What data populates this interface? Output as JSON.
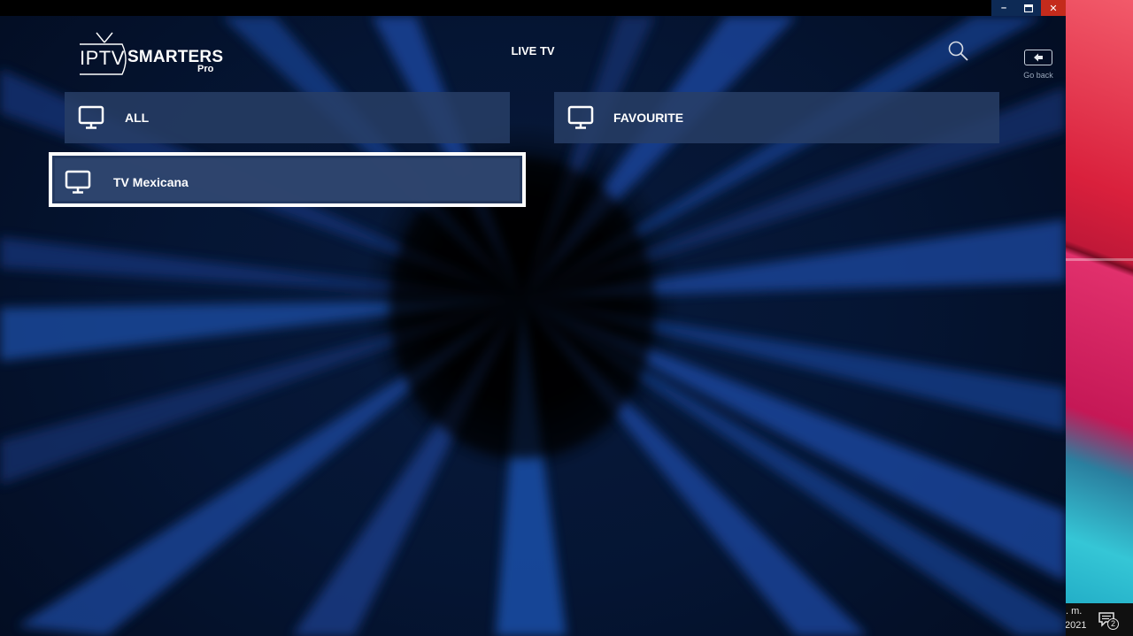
{
  "app": {
    "logo_main": "IPTV",
    "logo_brand": "SMARTERS",
    "logo_sub": "Pro",
    "page_title": "LIVE TV",
    "go_back_label": "Go back"
  },
  "window_controls": {
    "minimize": "–",
    "maximize": "▭",
    "close": "✕"
  },
  "categories": [
    {
      "label": "ALL",
      "icon": "tv-icon"
    },
    {
      "label": "FAVOURITE",
      "icon": "tv-icon"
    },
    {
      "label": "TV Mexicana",
      "icon": "tv-icon",
      "selected": true
    }
  ],
  "taskbar": {
    "time": ". m.",
    "date": "2021",
    "notification_count": "2"
  },
  "colors": {
    "tile_bg": "#283e66",
    "selected_border": "#ffffff",
    "background": "#051533",
    "close_button": "#c42b1c"
  }
}
